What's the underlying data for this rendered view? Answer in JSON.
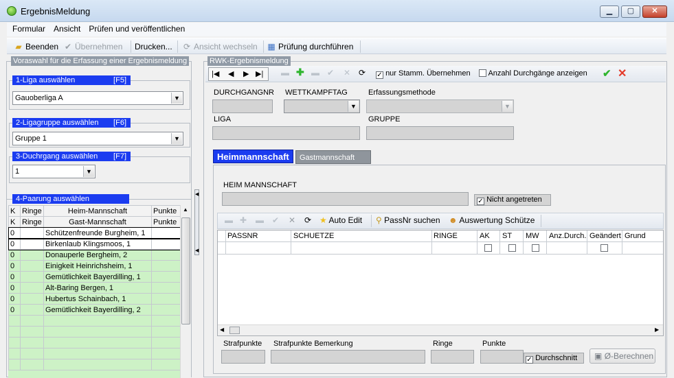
{
  "window": {
    "title": "ErgebnisMeldung"
  },
  "menu": [
    "Formular",
    "Ansicht",
    "Prüfen und veröffentlichen"
  ],
  "toolbar": {
    "beenden": "Beenden",
    "uebernehmen": "Übernehmen",
    "drucken": "Drucken...",
    "ansicht_wechseln": "Ansicht wechseln",
    "pruefung": "Prüfung durchführen"
  },
  "left": {
    "legend": "Voraswahl für die Erfassung einer Ergebnismeldung",
    "liga_label": "1-Liga auswählen",
    "liga_key": "[F5]",
    "liga_value": "Gauoberliga A",
    "gruppe_label": "2-Ligagruppe auswählen",
    "gruppe_key": "[F6]",
    "gruppe_value": "Gruppe 1",
    "durchgang_label": "3-Duchrgang auswählen",
    "durchgang_key": "[F7]",
    "durchgang_value": "1",
    "paarung_label": "4-Paarung auswählen",
    "paarung_headers1": [
      "K",
      "Ringe",
      "Heim-Mannschaft",
      "Punkte"
    ],
    "paarung_headers2": [
      "K",
      "Ringe",
      "Gast-Mannschaft",
      "Punkte"
    ],
    "paarung_rows": [
      {
        "k": "0",
        "ringe": "",
        "name": "Schützenfreunde Burgheim, 1",
        "punkte": ""
      },
      {
        "k": "0",
        "ringe": "",
        "name": "Birkenlaub Klingsmoos, 1",
        "punkte": ""
      },
      {
        "k": "0",
        "ringe": "",
        "name": "Donauperle Bergheim, 2",
        "punkte": ""
      },
      {
        "k": "0",
        "ringe": "",
        "name": "Einigkeit Heinrichsheim, 1",
        "punkte": ""
      },
      {
        "k": "0",
        "ringe": "",
        "name": "Gemütlichkeit Bayerdilling, 1",
        "punkte": ""
      },
      {
        "k": "0",
        "ringe": "",
        "name": "Alt-Baring Bergen, 1",
        "punkte": ""
      },
      {
        "k": "0",
        "ringe": "",
        "name": "Hubertus Schainbach, 1",
        "punkte": ""
      },
      {
        "k": "0",
        "ringe": "",
        "name": "Gemütlichkeit Bayerdilling, 2",
        "punkte": ""
      }
    ]
  },
  "rwk": {
    "legend": "RWK-Ergebnismeldung",
    "nur_stamm": "nur Stamm. Übernehmen",
    "anzahl": "Anzahl Durchgänge anzeigen",
    "durchgangnr": "DURCHGANGNR",
    "wettkampftag": "WETTKAMPFTAG",
    "erfassung": "Erfassungsmethode",
    "liga": "LIGA",
    "gruppe": "GRUPPE",
    "tab_heim": "Heimmannschaft",
    "tab_gast": "Gastmannschaft",
    "heim_label": "HEIM MANNSCHAFT",
    "nicht_angetreten": "Nicht angetreten",
    "auto_edit": "Auto Edit",
    "passnr_suchen": "PassNr suchen",
    "auswertung": "Auswertung Schütze",
    "grid_headers": [
      "PASSNR",
      "SCHUETZE",
      "RINGE",
      "AK",
      "ST",
      "MW",
      "Anz.Durch.",
      "Geändert",
      "Grund"
    ],
    "strafpunkte": "Strafpunkte",
    "strafpunkte_bem": "Strafpunkte Bemerkung",
    "ringe": "Ringe",
    "punkte": "Punkte",
    "durchschnitt": "Durchschnitt",
    "berechnen": "Ø-Berechnen"
  }
}
